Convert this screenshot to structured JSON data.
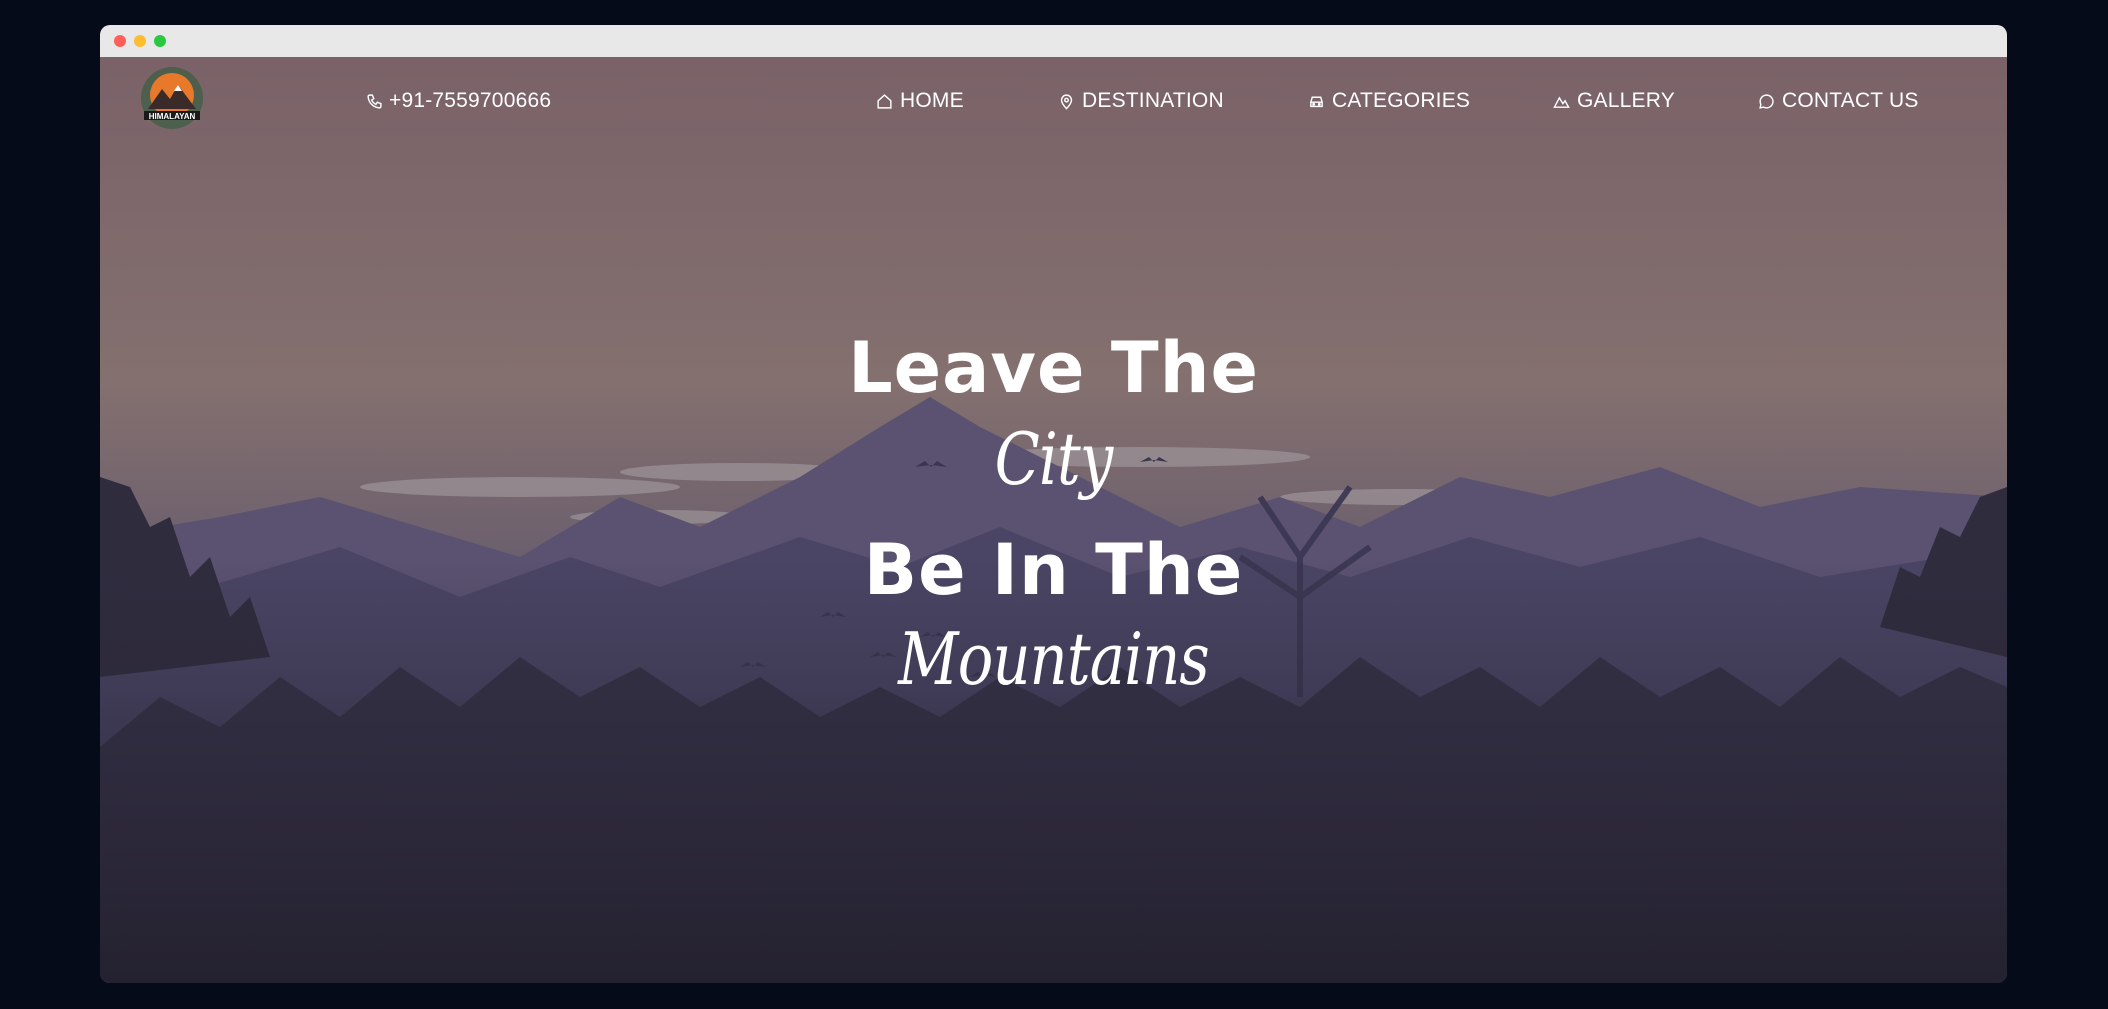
{
  "window": {
    "controls": [
      "close",
      "minimize",
      "maximize"
    ]
  },
  "brand": {
    "logo_text": "HIMALAYAN",
    "logo_icon": "mountain-sun-logo"
  },
  "contact": {
    "phone": "+91-7559700666",
    "icon": "phone-icon"
  },
  "nav": {
    "items": [
      {
        "label": "HOME",
        "icon": "home-icon"
      },
      {
        "label": "DESTINATION",
        "icon": "map-pin-icon"
      },
      {
        "label": "CATEGORIES",
        "icon": "car-icon"
      },
      {
        "label": "GALLERY",
        "icon": "mountain-icon"
      },
      {
        "label": "CONTACT US",
        "icon": "chat-bubble-icon"
      }
    ]
  },
  "hero": {
    "line1": "Leave The",
    "line2": "City",
    "line3": "Be In The",
    "line4": "Mountains"
  },
  "colors": {
    "page_bg": "#060b1a",
    "sky_top": "#7a6268",
    "sky_mid": "#85706f",
    "forest_dark": "#2a2638",
    "text": "#ffffff"
  }
}
